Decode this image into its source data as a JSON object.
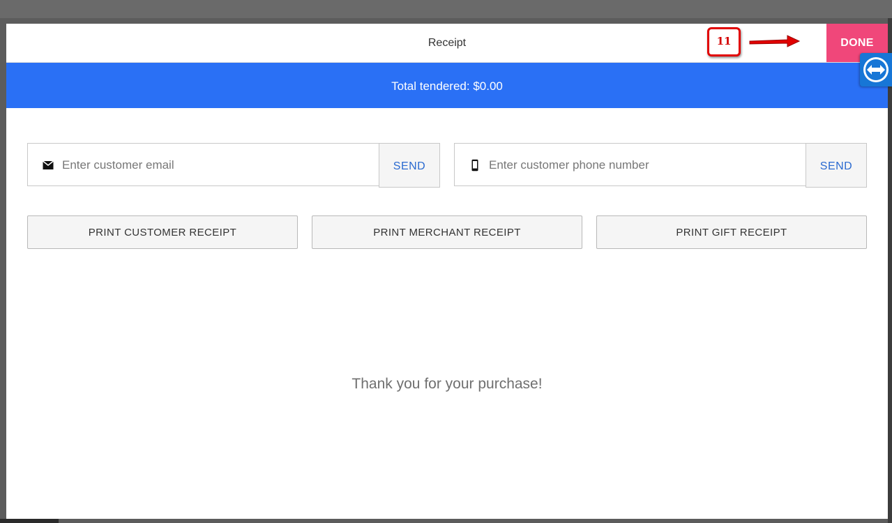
{
  "header": {
    "title": "Receipt",
    "done_label": "DONE"
  },
  "annotation": {
    "step": "11",
    "color": "#e10000"
  },
  "total_bar": {
    "text": "Total tendered: $0.00",
    "color": "#2a70f5"
  },
  "email": {
    "icon": "mail-icon",
    "placeholder": "Enter customer email",
    "value": "",
    "send_label": "SEND"
  },
  "phone": {
    "icon": "smartphone-icon",
    "placeholder": "Enter customer phone number",
    "value": "",
    "send_label": "SEND"
  },
  "print_buttons": [
    {
      "label": "PRINT CUSTOMER RECEIPT"
    },
    {
      "label": "PRINT MERCHANT RECEIPT"
    },
    {
      "label": "PRINT GIFT RECEIPT"
    }
  ],
  "message": "Thank you for your purchase!",
  "colors": {
    "accent_done": "#f0477a",
    "link": "#2a6ad0"
  },
  "overlay": {
    "icon": "teamviewer-icon"
  }
}
